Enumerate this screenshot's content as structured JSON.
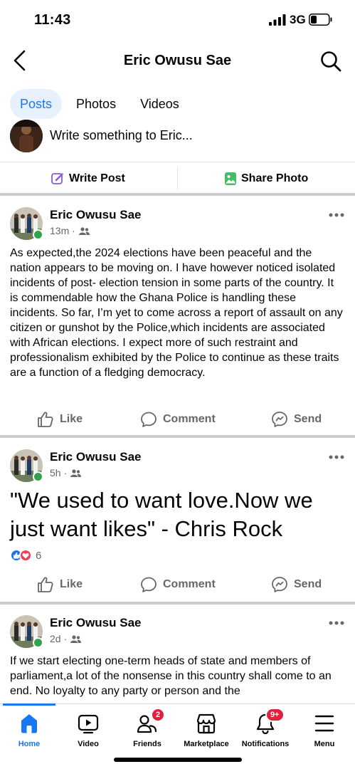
{
  "status_bar": {
    "time": "11:43",
    "network": "3G"
  },
  "header": {
    "title": "Eric Owusu Sae"
  },
  "tabs": [
    {
      "label": "Posts",
      "active": true
    },
    {
      "label": "Photos",
      "active": false
    },
    {
      "label": "Videos",
      "active": false
    }
  ],
  "composer": {
    "placeholder": "Write something to Eric...",
    "write_post_label": "Write Post",
    "share_photo_label": "Share Photo"
  },
  "posts": [
    {
      "author": "Eric Owusu Sae",
      "time": "13m",
      "audience_icon": "friends-icon",
      "text": "As expected,the 2024 elections have been peaceful and the nation appears to be moving on. I have however noticed isolated incidents of post- election tension in some parts of the country. It is commendable how the Ghana Police is handling these incidents. So far, I’m yet to come across a report of assault on any citizen or gunshot by the Police,which incidents are associated with African elections. I expect more of such restraint and professionalism exhibited by the Police to continue as these traits are a function of a fledging democracy."
    },
    {
      "author": "Eric Owusu Sae",
      "time": "5h",
      "audience_icon": "friends-icon",
      "text": "\"We used to want love.Now we just want likes\" - Chris Rock",
      "reaction_count": "6"
    },
    {
      "author": "Eric Owusu Sae",
      "time": "2d",
      "audience_icon": "friends-icon",
      "text": "If we start electing one-term heads of state and members of parliament,a lot of the nonsense in this country shall come to an end. No loyalty to any party or person and the"
    }
  ],
  "post_actions": {
    "like": "Like",
    "comment": "Comment",
    "send": "Send"
  },
  "bottom_nav": [
    {
      "label": "Home",
      "icon": "home-icon",
      "active": true
    },
    {
      "label": "Video",
      "icon": "video-icon"
    },
    {
      "label": "Friends",
      "icon": "friends-icon",
      "badge": "2"
    },
    {
      "label": "Marketplace",
      "icon": "marketplace-icon"
    },
    {
      "label": "Notifications",
      "icon": "bell-icon",
      "badge": "9+"
    },
    {
      "label": "Menu",
      "icon": "menu-icon"
    }
  ],
  "colors": {
    "accent": "#1877f2",
    "online": "#31a24c",
    "badge": "#e41e3f",
    "secondary_text": "#65676b"
  }
}
